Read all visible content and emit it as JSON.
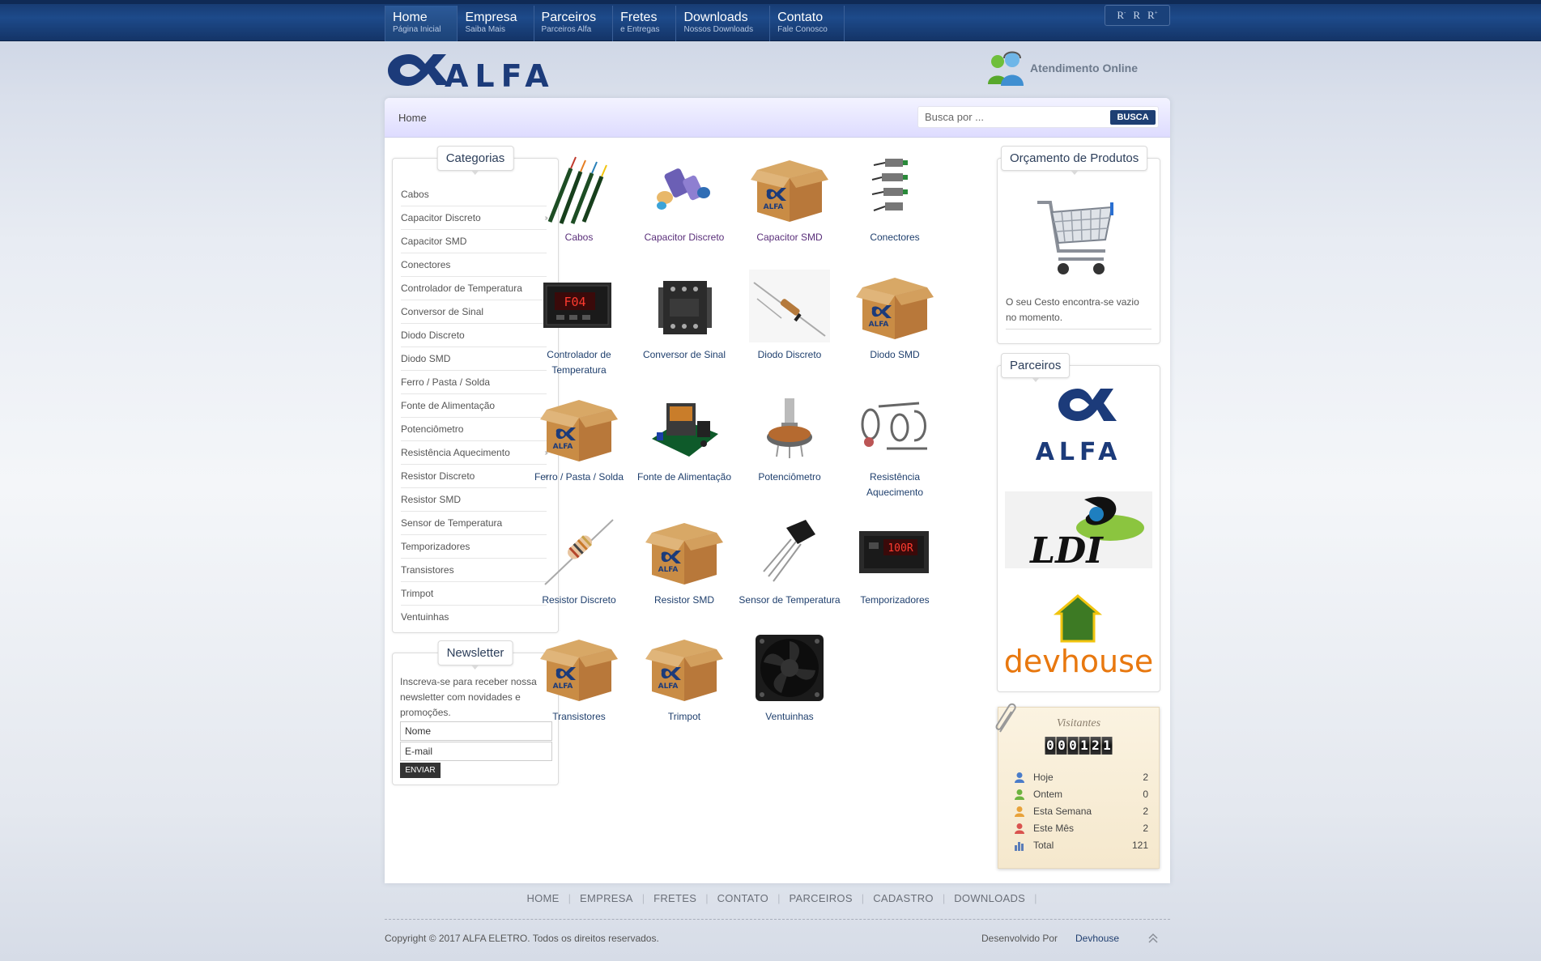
{
  "nav": [
    {
      "title": "Home",
      "sub": "Página Inicial"
    },
    {
      "title": "Empresa",
      "sub": "Saiba Mais"
    },
    {
      "title": "Parceiros",
      "sub": "Parceiros Alfa"
    },
    {
      "title": "Fretes",
      "sub": "e Entregas"
    },
    {
      "title": "Downloads",
      "sub": "Nossos Downloads"
    },
    {
      "title": "Contato",
      "sub": "Fale Conosco"
    }
  ],
  "font_tools": {
    "reset": "R",
    "decrease": "R",
    "increase": "R",
    "minus": "-",
    "plus": "+"
  },
  "header": {
    "logo_text": "ALFA",
    "online_label": "Atendimento Online"
  },
  "breadcrumb": "Home",
  "search": {
    "placeholder": "Busca por ...",
    "button": "BUSCA"
  },
  "categories": {
    "title": "Categorias",
    "items": [
      {
        "label": "Cabos",
        "arrow": ""
      },
      {
        "label": "Capacitor Discreto",
        "arrow": "››"
      },
      {
        "label": "Capacitor SMD",
        "arrow": ""
      },
      {
        "label": "Conectores",
        "arrow": ""
      },
      {
        "label": "Controlador de Temperatura",
        "arrow": "››"
      },
      {
        "label": "Conversor de Sinal",
        "arrow": ""
      },
      {
        "label": "Diodo Discreto",
        "arrow": ""
      },
      {
        "label": "Diodo SMD",
        "arrow": ""
      },
      {
        "label": "Ferro / Pasta / Solda",
        "arrow": ""
      },
      {
        "label": "Fonte de Alimentação",
        "arrow": ""
      },
      {
        "label": "Potenciômetro",
        "arrow": ""
      },
      {
        "label": "Resistência Aquecimento",
        "arrow": "››"
      },
      {
        "label": "Resistor Discreto",
        "arrow": "››"
      },
      {
        "label": "Resistor SMD",
        "arrow": ""
      },
      {
        "label": "Sensor de Temperatura",
        "arrow": ""
      },
      {
        "label": "Temporizadores",
        "arrow": ""
      },
      {
        "label": "Transistores",
        "arrow": ""
      },
      {
        "label": "Trimpot",
        "arrow": ""
      },
      {
        "label": "Ventuinhas",
        "arrow": ""
      }
    ]
  },
  "newsletter": {
    "title": "Newsletter",
    "text": "Inscreva-se para receber nossa newsletter com novidades e promoções.",
    "name_placeholder": "Nome",
    "email_placeholder": "E-mail",
    "button": "ENVIAR"
  },
  "products": [
    {
      "label": "Cabos",
      "icon": "cables-image"
    },
    {
      "label": "Capacitor Discreto",
      "icon": "capacitor-image"
    },
    {
      "label": "Capacitor SMD",
      "icon": "alfa-box-image"
    },
    {
      "label": "Conectores",
      "icon": "connectors-image"
    },
    {
      "label": "Controlador de Temperatura",
      "icon": "controller-image"
    },
    {
      "label": "Conversor de Sinal",
      "icon": "converter-image"
    },
    {
      "label": "Diodo Discreto",
      "icon": "diode-image"
    },
    {
      "label": "Diodo SMD",
      "icon": "alfa-box-image"
    },
    {
      "label": "Ferro / Pasta / Solda",
      "icon": "alfa-box-image"
    },
    {
      "label": "Fonte de Alimentação",
      "icon": "power-supply-image"
    },
    {
      "label": "Potenciômetro",
      "icon": "potentiometer-image"
    },
    {
      "label": "Resistência Aquecimento",
      "icon": "heater-image"
    },
    {
      "label": "Resistor Discreto",
      "icon": "resistor-image"
    },
    {
      "label": "Resistor SMD",
      "icon": "alfa-box-image"
    },
    {
      "label": "Sensor de Temperatura",
      "icon": "sensor-image"
    },
    {
      "label": "Temporizadores",
      "icon": "timer-image"
    },
    {
      "label": "Transistores",
      "icon": "alfa-box-image"
    },
    {
      "label": "Trimpot",
      "icon": "alfa-box-image"
    },
    {
      "label": "Ventuinhas",
      "icon": "fan-image"
    }
  ],
  "cart": {
    "title": "Orçamento de Produtos",
    "text": "O seu Cesto encontra-se vazio no momento."
  },
  "partners": {
    "title": "Parceiros",
    "items": [
      "ALFA",
      "LDI",
      "devhouse"
    ]
  },
  "visitors": {
    "title": "Visitantes",
    "counter": "000121",
    "rows": [
      {
        "label": "Hoje",
        "value": "2",
        "color": "#4a7cc9"
      },
      {
        "label": "Ontem",
        "value": "0",
        "color": "#6db33f"
      },
      {
        "label": "Esta Semana",
        "value": "2",
        "color": "#e8a23a"
      },
      {
        "label": "Este Mês",
        "value": "2",
        "color": "#d9534f"
      },
      {
        "label": "Total",
        "value": "121",
        "color": "#5b7db8"
      }
    ]
  },
  "footer": {
    "links": [
      "HOME",
      "EMPRESA",
      "FRETES",
      "CONTATO",
      "PARCEIROS",
      "CADASTRO",
      "DOWNLOADS"
    ],
    "copyright": "Copyright © 2017 ALFA ELETRO. Todos os direitos reservados.",
    "dev_by": "Desenvolvido Por",
    "dev_link": "Devhouse"
  }
}
